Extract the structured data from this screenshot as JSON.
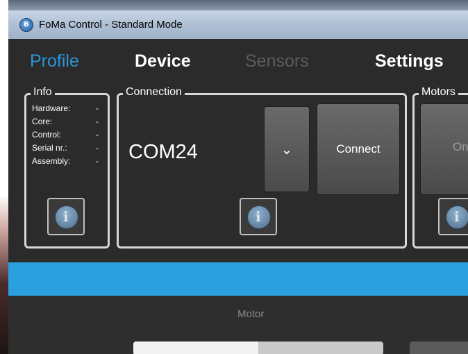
{
  "window": {
    "title": "FoMa Control - Standard Mode",
    "app_icon_glyph": "B"
  },
  "tabs": [
    {
      "label": "Profile",
      "state": "active"
    },
    {
      "label": "Device",
      "state": "normal"
    },
    {
      "label": "Sensors",
      "state": "disabled"
    },
    {
      "label": "Settings",
      "state": "normal"
    }
  ],
  "info": {
    "legend": "Info",
    "rows": [
      {
        "label": "Hardware:",
        "value": "-"
      },
      {
        "label": "Core:",
        "value": "-"
      },
      {
        "label": "Control:",
        "value": "-"
      },
      {
        "label": "Serial nr.:",
        "value": "-"
      },
      {
        "label": "Assembly:",
        "value": "-"
      }
    ],
    "info_glyph": "i"
  },
  "connection": {
    "legend": "Connection",
    "port": "COM24",
    "dropdown_glyph": "⌄",
    "connect_label": "Connect",
    "info_glyph": "i"
  },
  "motors": {
    "legend": "Motors",
    "button_label": "On",
    "info_glyph": "i"
  },
  "motor_panel": {
    "label": "Motor",
    "slider_fraction": 0.5
  },
  "colors": {
    "accent": "#2d94d8",
    "band": "#2aa0df",
    "background": "#2b2b2b"
  }
}
